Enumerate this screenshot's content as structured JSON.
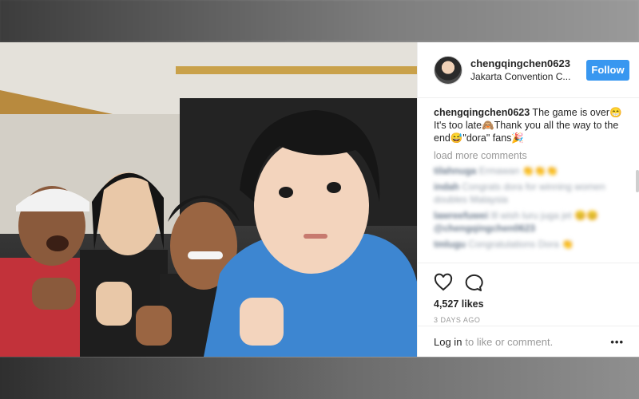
{
  "post": {
    "username": "chengqingchen0623",
    "location": "Jakarta Convention C...",
    "follow_label": "Follow",
    "caption_user": "chengqingchen0623",
    "caption_text": " The game is over😁It's too late🙈Thank you all the way to the end😅\"dora\" fans🎉",
    "load_more": "load more comments",
    "likes": "4,527 likes",
    "time_ago": "3 DAYS AGO",
    "login_link": "Log in",
    "login_suffix": "to like or comment.",
    "more_glyph": "•••"
  },
  "blurred_comments": [
    {
      "user": "tilahnuga",
      "text": "Ermawan 👏👏👏"
    },
    {
      "user": "indah",
      "text": "Congrats dora for winning women doubles Malaysia"
    },
    {
      "user": "lawreefuwei",
      "text": "Ill wish luru juga jet 😊😊"
    },
    {
      "user": "@chengqingchen0623",
      "text": ""
    },
    {
      "user": "tmlugu",
      "text": "Congratulations Dora 👏"
    }
  ],
  "icons": {
    "like": "heart-outline-icon",
    "comment": "speech-bubble-icon"
  },
  "colors": {
    "follow_button": "#3897f0",
    "text": "#262626",
    "muted": "#999999"
  }
}
